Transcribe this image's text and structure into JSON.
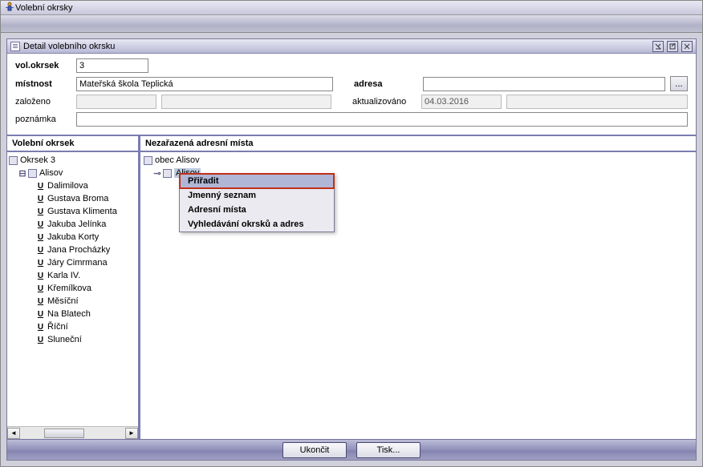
{
  "outer_window": {
    "title": "Volební okrsky"
  },
  "inner_window": {
    "title": "Detail volebního okrsku"
  },
  "form": {
    "vol_okrsek_label": "vol.okrsek",
    "vol_okrsek_value": "3",
    "mistnost_label": "místnost",
    "mistnost_value": "Mateřská škola Teplická",
    "adresa_label": "adresa",
    "adresa_value": "",
    "zalozeno_label": "založeno",
    "zalozeno_date": "",
    "zalozeno_user": "",
    "aktualizovano_label": "aktualizováno",
    "aktualizovano_date": "04.03.2016",
    "aktualizovano_user": "",
    "poznamka_label": "poznámka",
    "poznamka_value": "",
    "ellipsis": "..."
  },
  "left_panel": {
    "title": "Volební okrsek",
    "root": "Okrsek 3",
    "obec": "Alisov",
    "streets": [
      "Dalimilova",
      "Gustava Broma",
      "Gustava Klimenta",
      "Jakuba Jelínka",
      "Jakuba Korty",
      "Jana Procházky",
      "Járy Cimrmana",
      "Karla IV.",
      "Křemílkova",
      "Měsíční",
      "Na Blatech",
      "Říční",
      "Sluneční"
    ]
  },
  "right_panel": {
    "title": "Nezařazená adresní místa",
    "root": "obec Alisov",
    "selected": "Alisov"
  },
  "context_menu": {
    "items": [
      "Přiřadit",
      "Jmenný seznam",
      "Adresní místa",
      "Vyhledávání okrsků a adres"
    ]
  },
  "buttons": {
    "close": "Ukončit",
    "print": "Tisk..."
  }
}
